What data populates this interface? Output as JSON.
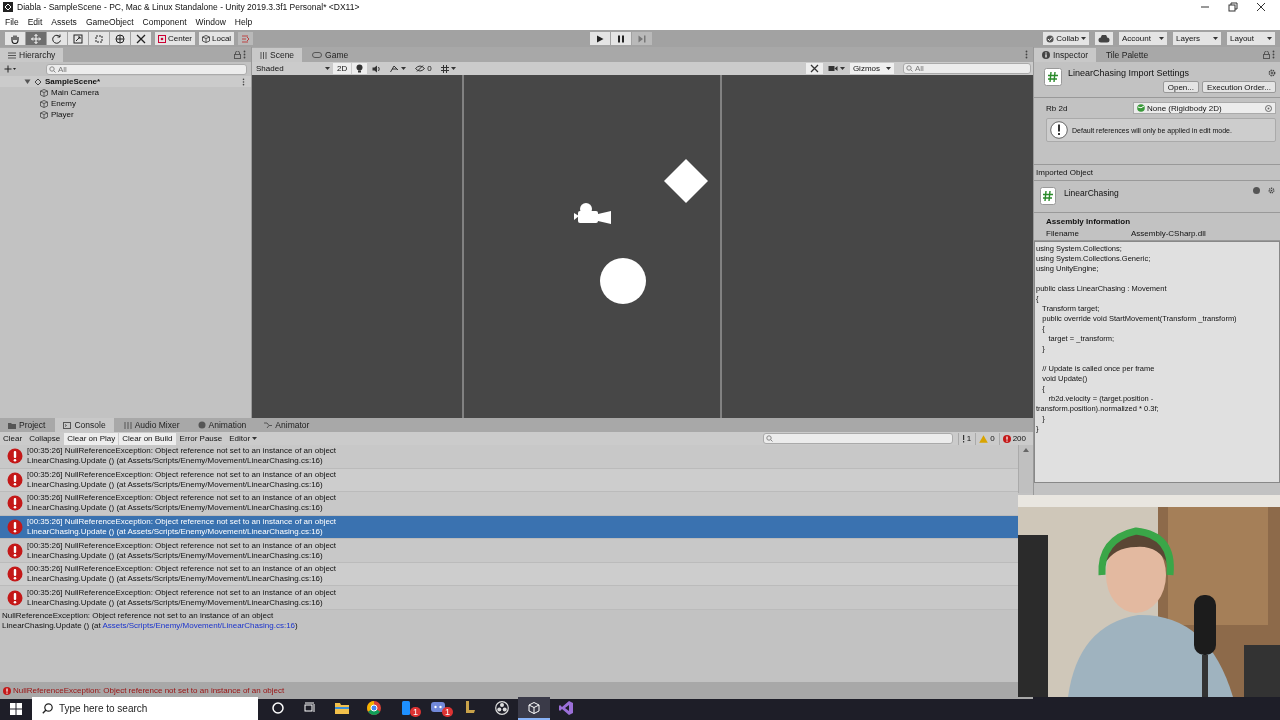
{
  "window": {
    "title": "Diabla - SampleScene - PC, Mac & Linux Standalone - Unity 2019.3.3f1 Personal* <DX11>"
  },
  "menu": [
    "File",
    "Edit",
    "Assets",
    "GameObject",
    "Component",
    "Window",
    "Help"
  ],
  "toolbar": {
    "tools": [
      {
        "kind": "hand",
        "selected": false
      },
      {
        "kind": "move",
        "selected": true
      },
      {
        "kind": "rotate",
        "selected": false
      },
      {
        "kind": "scale",
        "selected": false
      },
      {
        "kind": "rect",
        "selected": false
      },
      {
        "kind": "transform",
        "selected": false
      },
      {
        "kind": "custom",
        "selected": false
      }
    ],
    "pivot": "Center",
    "space": "Local",
    "right": [
      "Collab",
      "Account",
      "Layers",
      "Layout"
    ]
  },
  "hierarchy": {
    "title": "Hierarchy",
    "search_placeholder": "All",
    "scene": {
      "name": "SampleScene*",
      "expanded": true,
      "children": [
        {
          "name": "Main Camera"
        },
        {
          "name": "Enemy"
        },
        {
          "name": "Player"
        }
      ]
    }
  },
  "scene_view": {
    "tabs": [
      {
        "label": "Scene",
        "selected": true
      },
      {
        "label": "Game",
        "selected": false
      }
    ],
    "shading": "Shaded",
    "mode_2d": {
      "label": "2D",
      "on": true
    },
    "lighting": {
      "on": true
    },
    "audio": {
      "on": false
    },
    "hidden_count": "0",
    "tools_toggle": {
      "on": true
    },
    "gizmos": "Gizmos",
    "search_placeholder": "All"
  },
  "inspector": {
    "tabs": [
      {
        "label": "Inspector",
        "selected": true
      },
      {
        "label": "Tile Palette",
        "selected": false
      }
    ],
    "title": "LinearChasing Import Settings",
    "buttons": [
      "Open...",
      "Execution Order..."
    ],
    "field": {
      "label": "Rb 2d",
      "value": "None (Rigidbody 2D)"
    },
    "help": "Default references will only be applied in edit mode.",
    "imported_header": "Imported Object",
    "script_name": "LinearChasing",
    "assembly_title": "Assembly Information",
    "filename_label": "Filename",
    "filename": "Assembly-CSharp.dll",
    "code": [
      [
        "using System.Collections;",
        "using System.Collections.Generic;",
        "using UnityEngine;"
      ],
      [
        "public class LinearChasing : Movement",
        "{",
        "   Transform target;",
        "   public override void StartMovement(Transform _transform)",
        "   {",
        "      target = _transform;",
        "   }"
      ],
      [
        "   // Update is called once per frame",
        "   void Update()",
        "   {",
        "      rb2d.velocity = (target.position -",
        "transform.position).normalized * 0.3f;",
        "   }",
        "}"
      ]
    ]
  },
  "console": {
    "tabs": [
      {
        "label": "Project",
        "selected": false
      },
      {
        "label": "Console",
        "selected": true
      },
      {
        "label": "Audio Mixer",
        "selected": false
      },
      {
        "label": "Animation",
        "selected": false
      },
      {
        "label": "Animator",
        "selected": false
      }
    ],
    "buttons": [
      {
        "label": "Clear",
        "on": false
      },
      {
        "label": "Collapse",
        "on": false
      },
      {
        "label": "Clear on Play",
        "on": true
      },
      {
        "label": "Clear on Build",
        "on": true
      },
      {
        "label": "Error Pause",
        "on": false
      }
    ],
    "editor": "Editor",
    "counts": {
      "log": "1",
      "warning": "0",
      "error": "200"
    },
    "entries": [
      {
        "message": "[00:35:26] NullReferenceException: Object reference not set to an instance of an object",
        "trace": "LinearChasing.Update () (at Assets/Scripts/Enemy/Movement/LinearChasing.cs:16)",
        "selected": false
      },
      {
        "message": "[00:35:26] NullReferenceException: Object reference not set to an instance of an object",
        "trace": "LinearChasing.Update () (at Assets/Scripts/Enemy/Movement/LinearChasing.cs:16)",
        "selected": false
      },
      {
        "message": "[00:35:26] NullReferenceException: Object reference not set to an instance of an object",
        "trace": "LinearChasing.Update () (at Assets/Scripts/Enemy/Movement/LinearChasing.cs:16)",
        "selected": false
      },
      {
        "message": "[00:35:26] NullReferenceException: Object reference not set to an instance of an object",
        "trace": "LinearChasing.Update () (at Assets/Scripts/Enemy/Movement/LinearChasing.cs:16)",
        "selected": true
      },
      {
        "message": "[00:35:26] NullReferenceException: Object reference not set to an instance of an object",
        "trace": "LinearChasing.Update () (at Assets/Scripts/Enemy/Movement/LinearChasing.cs:16)",
        "selected": false
      },
      {
        "message": "[00:35:26] NullReferenceException: Object reference not set to an instance of an object",
        "trace": "LinearChasing.Update () (at Assets/Scripts/Enemy/Movement/LinearChasing.cs:16)",
        "selected": false
      },
      {
        "message": "[00:35:26] NullReferenceException: Object reference not set to an instance of an object",
        "trace": "LinearChasing.Update () (at Assets/Scripts/Enemy/Movement/LinearChasing.cs:16)",
        "selected": false
      }
    ],
    "detail": {
      "message": "NullReferenceException: Object reference not set to an instance of an object",
      "trace_prefix": "LinearChasing.Update () (at ",
      "link": "Assets/Scripts/Enemy/Movement/LinearChasing.cs:16",
      "trace_suffix": ")"
    }
  },
  "status_bar": {
    "message": "NullReferenceException: Object reference not set to an instance of an object"
  },
  "taskbar": {
    "search_placeholder": "Type here to search",
    "apps": [
      {
        "kind": "cortana",
        "active": false
      },
      {
        "kind": "taskview",
        "active": false
      },
      {
        "kind": "explorer",
        "active": false
      },
      {
        "kind": "chrome",
        "active": false
      },
      {
        "kind": "phone",
        "active": false,
        "badge": "1"
      },
      {
        "kind": "discord",
        "active": false,
        "badge": "1"
      },
      {
        "kind": "league",
        "active": false
      },
      {
        "kind": "obs",
        "active": false
      },
      {
        "kind": "unity",
        "active": true
      },
      {
        "kind": "studio",
        "active": false
      }
    ]
  }
}
